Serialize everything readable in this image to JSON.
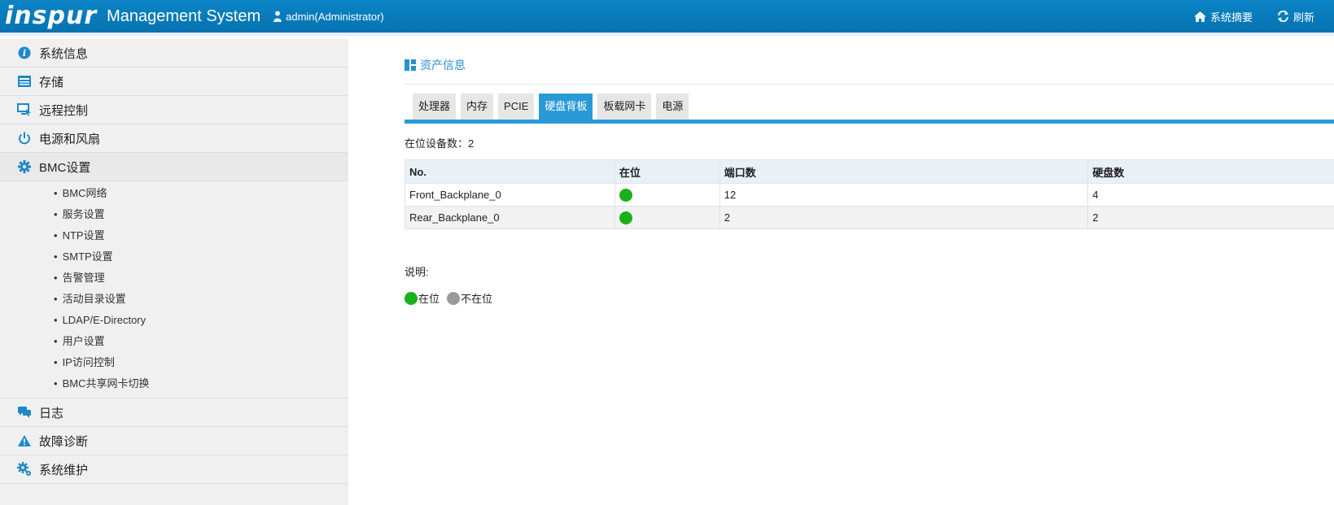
{
  "header": {
    "logo": "inspur",
    "title": "Management System",
    "user": "admin(Administrator)",
    "summary_label": "系统摘要",
    "refresh_label": "刷新"
  },
  "sidebar": {
    "items": [
      {
        "label": "系统信息",
        "icon": "info-icon"
      },
      {
        "label": "存储",
        "icon": "storage-icon"
      },
      {
        "label": "远程控制",
        "icon": "monitor-icon"
      },
      {
        "label": "电源和风扇",
        "icon": "power-icon"
      },
      {
        "label": "BMC设置",
        "icon": "gear-icon"
      },
      {
        "label": "日志",
        "icon": "chat-icon"
      },
      {
        "label": "故障诊断",
        "icon": "warning-icon"
      },
      {
        "label": "系统维护",
        "icon": "gears-icon"
      }
    ],
    "bmc_sub": [
      "BMC网络",
      "服务设置",
      "NTP设置",
      "SMTP设置",
      "告警管理",
      "活动目录设置",
      "LDAP/E-Directory",
      "用户设置",
      "IP访问控制",
      "BMC共享网卡切换"
    ]
  },
  "main": {
    "title": "资产信息",
    "tabs": [
      "处理器",
      "内存",
      "PCIE",
      "硬盘背板",
      "板载网卡",
      "电源"
    ],
    "active_tab": "硬盘背板",
    "count_label": "在位设备数：",
    "count_value": "2",
    "table": {
      "headers": [
        "No.",
        "在位",
        "端口数",
        "硬盘数"
      ],
      "rows": [
        {
          "no": "Front_Backplane_0",
          "present": true,
          "ports": "12",
          "disks": "4"
        },
        {
          "no": "Rear_Backplane_0",
          "present": true,
          "ports": "2",
          "disks": "2"
        }
      ]
    },
    "legend_label": "说明:",
    "legend": [
      {
        "label": "在位",
        "color": "#1bb01b"
      },
      {
        "label": "不在位",
        "color": "#9a9a9a"
      }
    ]
  },
  "colors": {
    "accent": "#2a9ad6",
    "header": "#0a84c6",
    "present": "#1bb01b",
    "absent": "#9a9a9a"
  }
}
